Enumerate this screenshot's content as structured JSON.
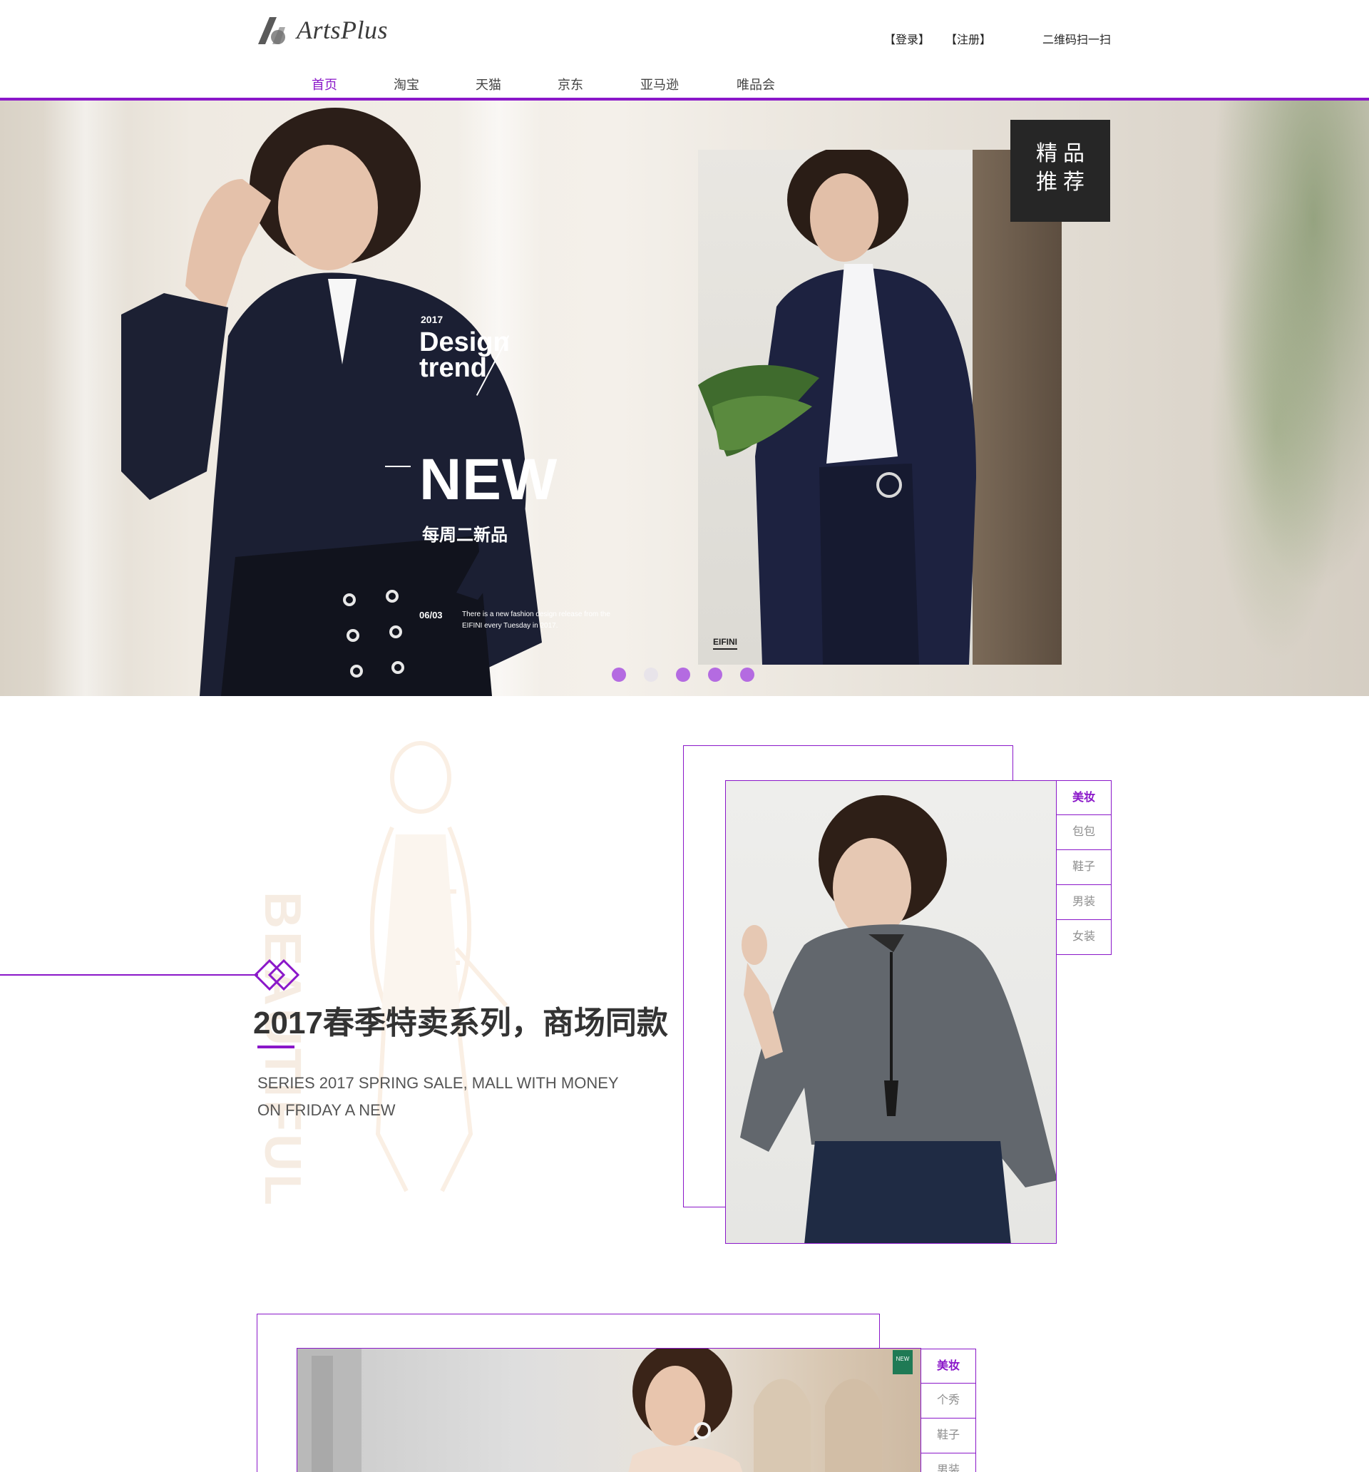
{
  "brand": {
    "name": "ArtsPlus"
  },
  "header": {
    "login": "【登录】",
    "register": "【注册】",
    "qr": "二维码扫一扫"
  },
  "nav": [
    {
      "label": "首页",
      "active": true
    },
    {
      "label": "淘宝",
      "active": false
    },
    {
      "label": "天猫",
      "active": false
    },
    {
      "label": "京东",
      "active": false
    },
    {
      "label": "亚马逊",
      "active": false
    },
    {
      "label": "唯品会",
      "active": false
    }
  ],
  "hero": {
    "year": "2017",
    "design": "Design",
    "trend": "trend",
    "new": "NEW",
    "weekly": "每周二新品",
    "date": "06/03",
    "small": "There is a new fashion design release from the EIFINI every Tuesday in 2017.",
    "photo_brand": "EIFINI",
    "badge_line1": "精品",
    "badge_line2": "推荐",
    "slides": [
      {
        "active": true
      },
      {
        "active": false
      },
      {
        "active": true
      },
      {
        "active": true
      },
      {
        "active": true
      }
    ]
  },
  "section1": {
    "bg_word": "BEAUTIFUL",
    "title": "2017春季特卖系列，商场同款",
    "sub1": "SERIES 2017 SPRING SALE, MALL WITH MONEY",
    "sub2": "ON FRIDAY A NEW",
    "tabs": [
      {
        "label": "美妆",
        "active": true
      },
      {
        "label": "包包",
        "active": false
      },
      {
        "label": "鞋子",
        "active": false
      },
      {
        "label": "男装",
        "active": false
      },
      {
        "label": "女装",
        "active": false
      }
    ]
  },
  "section2": {
    "new_tag": "NEW",
    "tabs": [
      {
        "label": "美妆",
        "active": true
      },
      {
        "label": "个秀",
        "active": false
      },
      {
        "label": "鞋子",
        "active": false
      },
      {
        "label": "男装",
        "active": false
      }
    ]
  },
  "colors": {
    "accent": "#8a17c9",
    "dot": "#b46be1",
    "badge": "#262626"
  }
}
